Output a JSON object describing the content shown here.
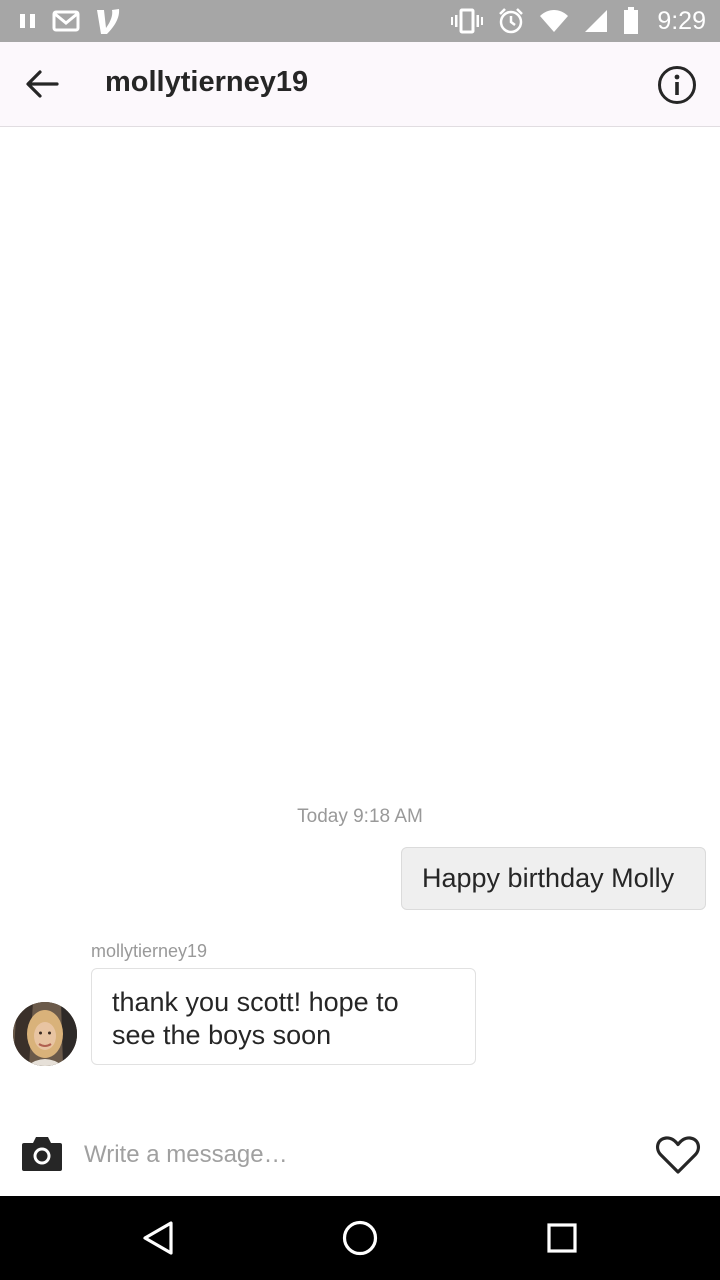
{
  "status_bar": {
    "time": "9:29",
    "left_icons": [
      "pause-icon",
      "gmail-icon",
      "venmo-icon"
    ],
    "right_icons": [
      "vibrate-icon",
      "alarm-icon",
      "wifi-icon",
      "signal-icon",
      "battery-icon"
    ]
  },
  "header": {
    "title": "mollytierney19",
    "back_icon": "arrow-left-icon",
    "info_icon": "info-icon"
  },
  "conversation": {
    "timestamp": "Today 9:18 AM",
    "messages": [
      {
        "direction": "outgoing",
        "text": "Happy birthday Molly"
      },
      {
        "direction": "incoming",
        "sender": "mollytierney19",
        "text_lines": [
          "thank you scott! hope to",
          "see the boys soon"
        ]
      }
    ]
  },
  "composer": {
    "placeholder": "Write a message…",
    "camera_icon": "camera-icon",
    "like_icon": "heart-icon"
  },
  "nav_bar": {
    "buttons": [
      "back-triangle-icon",
      "home-circle-icon",
      "recents-square-icon"
    ]
  },
  "colors": {
    "status_bar": "#a6a6a6",
    "header_bg": "#fcf8fc",
    "outgoing_bubble": "#efefef",
    "text": "#262626",
    "muted_text": "#999999"
  }
}
